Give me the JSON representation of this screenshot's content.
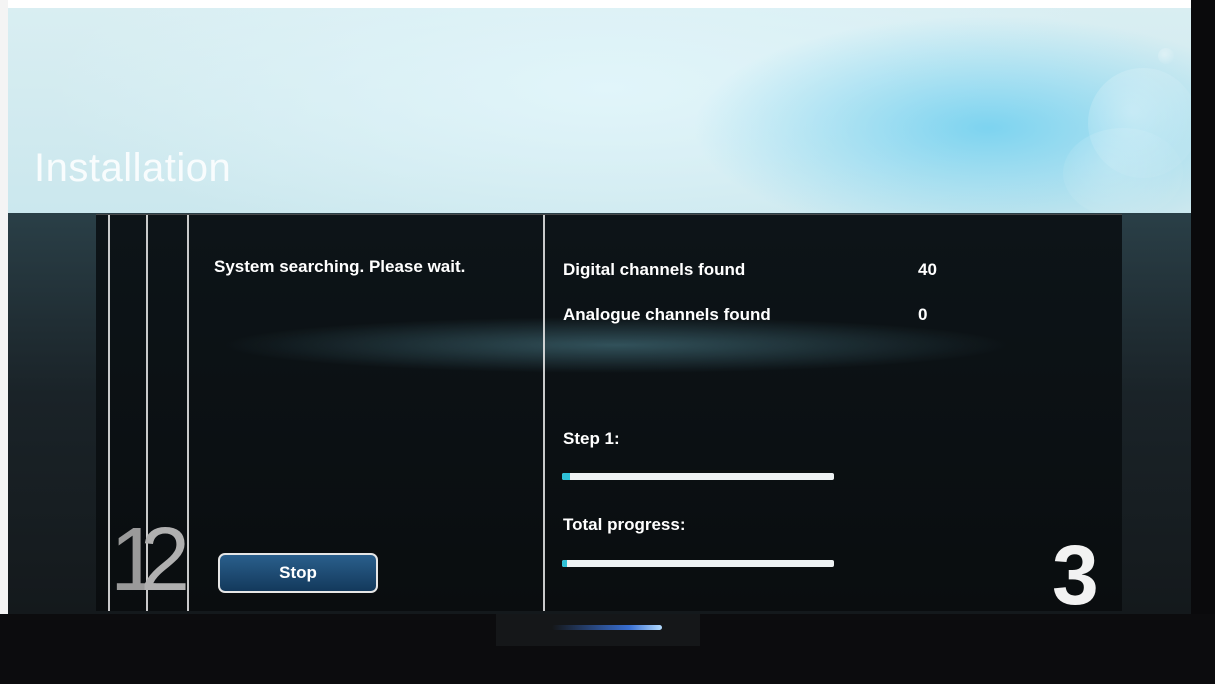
{
  "screen": {
    "title": "Installation"
  },
  "left_panel": {
    "status_text": "System searching. Please wait.",
    "stop_label": "Stop"
  },
  "results": {
    "digital_label": "Digital channels found",
    "digital_value": "40",
    "analogue_label": "Analogue channels found",
    "analogue_value": "0"
  },
  "progress": {
    "step_label": "Step 1:",
    "step_fraction": 0.03,
    "total_label": "Total progress:",
    "total_fraction": 0.02
  },
  "steps": {
    "one": "1",
    "two": "2",
    "three": "3"
  },
  "colors": {
    "progress_fill": "#2ec0d6",
    "button": "#1f4c75"
  }
}
